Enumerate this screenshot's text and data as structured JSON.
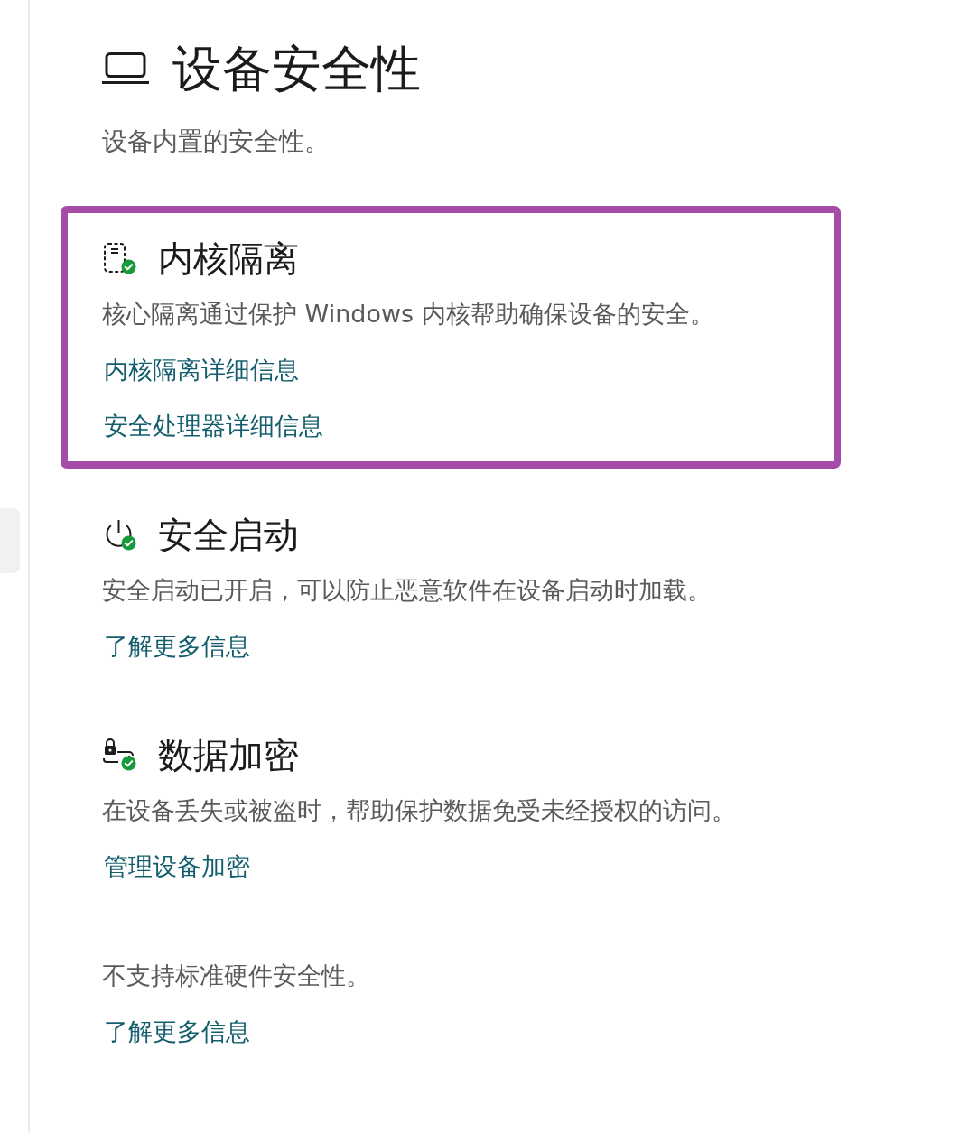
{
  "page": {
    "title": "设备安全性",
    "subtitle": "设备内置的安全性。"
  },
  "sections": [
    {
      "kind": "isolation",
      "title": "内核隔离",
      "protected": true,
      "highlighted": true,
      "description": "核心隔离通过保护 Windows 内核帮助确保设备的安全。",
      "links": [
        "内核隔离详细信息",
        "安全处理器详细信息"
      ]
    },
    {
      "kind": "boot",
      "title": "安全启动",
      "protected": true,
      "highlighted": false,
      "description": "安全启动已开启，可以防止恶意软件在设备启动时加载。",
      "links": [
        "了解更多信息"
      ]
    },
    {
      "kind": "encryption",
      "title": "数据加密",
      "protected": true,
      "highlighted": false,
      "description": "在设备丢失或被盗时，帮助保护数据免受未经授权的访问。",
      "links": [
        "管理设备加密"
      ]
    }
  ],
  "hardware_note": {
    "description": "不支持标准硬件安全性。",
    "link": "了解更多信息"
  }
}
